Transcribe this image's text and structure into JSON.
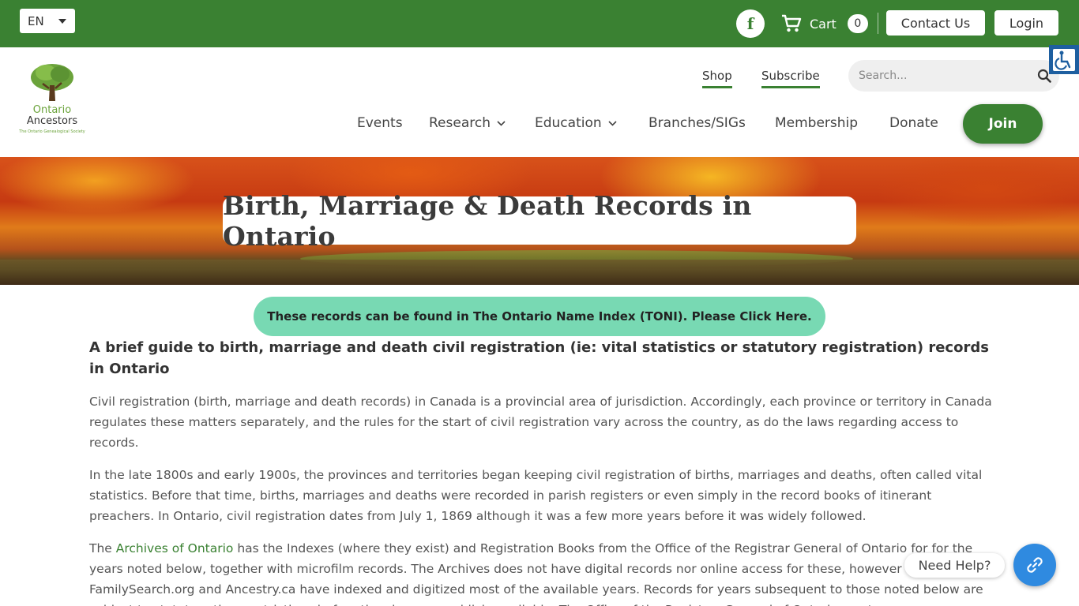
{
  "topbar": {
    "language": "EN",
    "social": "facebook-icon",
    "cart_label": "Cart",
    "cart_count": "0",
    "contact_label": "Contact Us",
    "login_label": "Login"
  },
  "header": {
    "logo_line1": "Ontario",
    "logo_line2": "Ancestors",
    "logo_tagline": "The Ontario Genealogical Society",
    "util_links": [
      "Shop",
      "Subscribe"
    ],
    "search_placeholder": "Search...",
    "nav": [
      "Events",
      "Research",
      "Education",
      "Branches/SIGs",
      "Membership",
      "Donate"
    ],
    "join_label": "Join"
  },
  "hero": {
    "title": "Birth, Marriage & Death Records in Ontario"
  },
  "content": {
    "toni_button": "These records can be found in The Ontario Name Index (TONI). Please Click Here.",
    "heading": "A brief guide to birth, marriage and death civil registration (ie: vital statistics or statutory registration) records in Ontario",
    "p1": "Civil registration (birth, marriage and death records) in Canada is a provincial area of jurisdiction. Accordingly, each province or territory in Canada regulates these matters separately, and the rules for the start of civil registration vary across the country, as do the laws regarding access to records.",
    "p2": "In the late 1800s and early 1900s, the provinces and territories began keeping civil registration of births, marriages and deaths, often called vital statistics. Before that time, births, marriages and deaths were recorded in parish registers or even simply in the record books of itinerant preachers.  In Ontario, civil registration dates from July 1, 1869 although it was a few more years before it was widely followed.",
    "p3_prefix": "The ",
    "p3_link": "Archives of Ontario",
    "p3_rest": " has the Indexes (where they exist) and Registration Books from the Office of the Registrar General of Ontario for for the years noted below, together with microfilm records. The Archives does not have digital records nor online access for these, however FamilySearch.org and Ancestry.ca have indexed and digitized most of the available years. Records for years subsequent to those noted below are subject to statutory time restrictions before they become publicly available. The Office of the Registrar General of Ontario must ..."
  },
  "floating": {
    "help_label": "Need Help?"
  },
  "colors": {
    "brand_green": "#3a8132",
    "toni_teal": "#78d9b3",
    "help_blue": "#2f8ae0"
  }
}
